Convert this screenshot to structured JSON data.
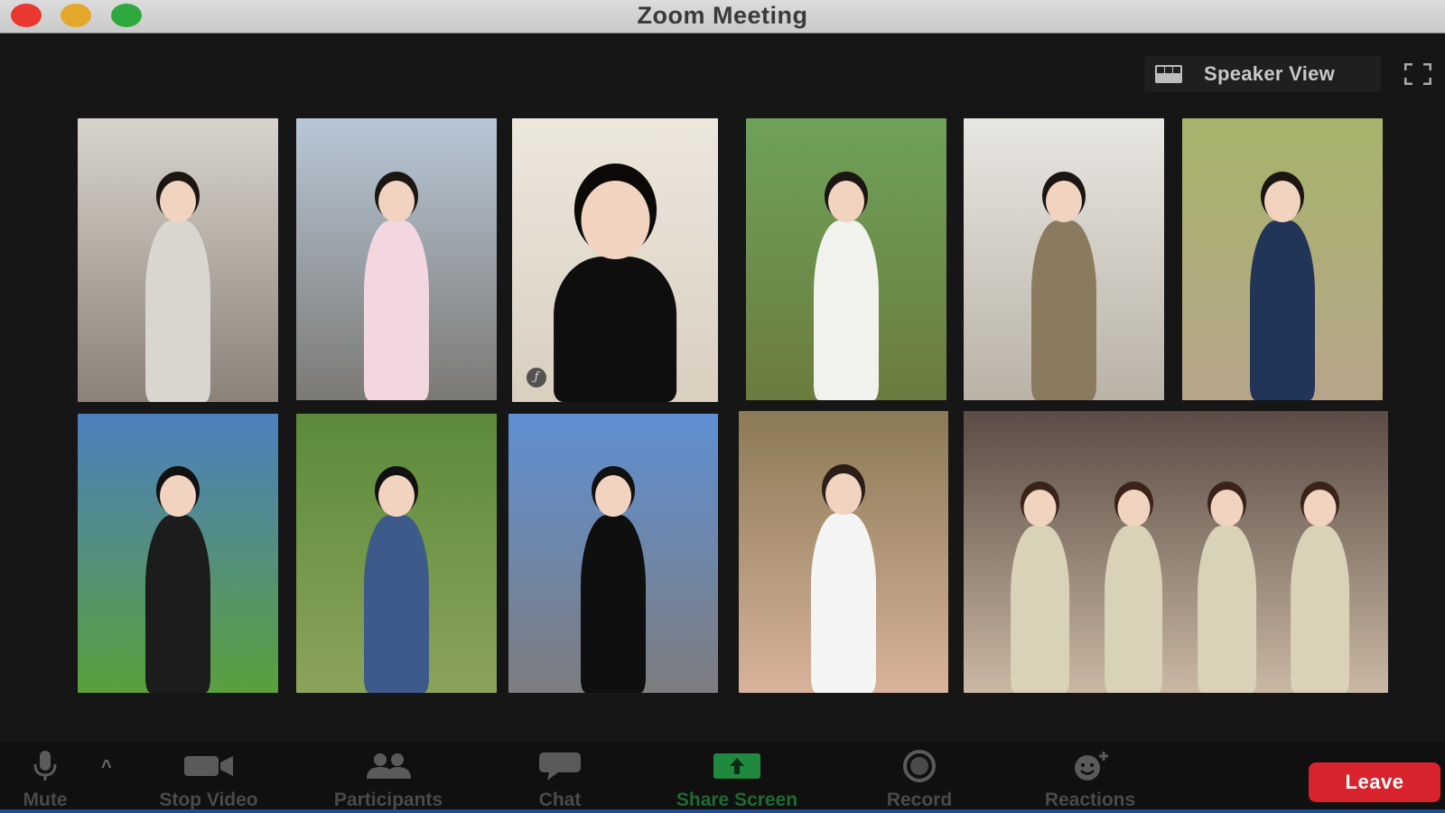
{
  "window": {
    "title": "Zoom Meeting"
  },
  "view_controls": {
    "speaker_view_label": "Speaker View",
    "grid_icon": "gallery-grid-icon",
    "fullscreen_icon": "fullscreen-icon"
  },
  "gallery": {
    "tiles": [
      {
        "scene": "indoor-mirror-selfie",
        "bg_top": "#d8d4cc",
        "bg_bottom": "#8b8278",
        "clothing": "#d9d6d0",
        "hair": "#1b1612"
      },
      {
        "scene": "street-at-sunset",
        "bg_top": "#b8c7d6",
        "bg_bottom": "#7b7975",
        "clothing": "#f2d7e0",
        "hair": "#1b1612"
      },
      {
        "scene": "close-up-portrait",
        "bg_top": "#ece7dd",
        "bg_bottom": "#d9cfbf",
        "clothing": "#0e0e0e",
        "hair": "#0c0a09",
        "badge": "ƒ"
      },
      {
        "scene": "lakeside-trees",
        "bg_top": "#6fa15a",
        "bg_bottom": "#6b7c3f",
        "clothing": "#f1f1ee",
        "hair": "#1b1612"
      },
      {
        "scene": "museum-statue",
        "bg_top": "#e8e6e2",
        "bg_bottom": "#b9b3a6",
        "clothing": "#8a7b5e",
        "hair": "#1b1612"
      },
      {
        "scene": "campus-plane-tree",
        "bg_top": "#a7b46a",
        "bg_bottom": "#b7a58a",
        "clothing": "#233459",
        "hair": "#1b1612"
      },
      {
        "scene": "mountain-meadow",
        "bg_top": "#4d7fbf",
        "bg_bottom": "#5aa03b",
        "clothing": "#1c1c1c",
        "hair": "#111"
      },
      {
        "scene": "grass-field-pose",
        "bg_top": "#5c8a3a",
        "bg_bottom": "#8ba35b",
        "clothing": "#3c5a8a",
        "hair": "#111"
      },
      {
        "scene": "highland-road",
        "bg_top": "#5f8fd2",
        "bg_bottom": "#7d7d7f",
        "clothing": "#0f0f0f",
        "hair": "#111"
      },
      {
        "scene": "mascot-costume",
        "bg_top": "#8a7a55",
        "bg_bottom": "#d9b29a",
        "clothing": "#f4f4f4",
        "hair": "#2a1e16"
      },
      {
        "scene": "group-dinner",
        "bg_top": "#5a4c44",
        "bg_bottom": "#c9b8a4",
        "clothing": "#d9d2b8",
        "hair": "#3a2419"
      }
    ]
  },
  "toolbar": {
    "mute": {
      "label": "Mute",
      "icon": "microphone-icon"
    },
    "audio_options": {
      "icon": "chevron-up-icon",
      "glyph": "^"
    },
    "stop_video": {
      "label": "Stop Video",
      "icon": "video-camera-icon"
    },
    "participants": {
      "label": "Participants",
      "icon": "participants-icon"
    },
    "chat": {
      "label": "Chat",
      "icon": "chat-bubble-icon"
    },
    "share_screen": {
      "label": "Share Screen",
      "icon": "share-screen-icon",
      "color": "#1f8a3d"
    },
    "record": {
      "label": "Record",
      "icon": "record-icon"
    },
    "reactions": {
      "label": "Reactions",
      "icon": "reactions-icon"
    },
    "leave": {
      "label": "Leave",
      "color": "#d8222c"
    }
  }
}
